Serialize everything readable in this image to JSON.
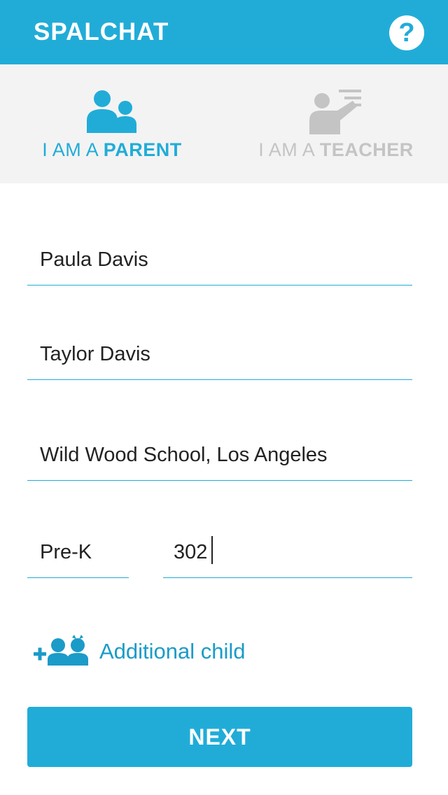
{
  "header": {
    "title": "SPALCHAT",
    "help_icon": "question-circle-icon",
    "help_glyph": "?"
  },
  "roles": {
    "selected": "parent",
    "parent": {
      "prefix": "I AM A ",
      "bold": "PARENT",
      "icon": "parent-child-icon",
      "color": "#21acd8"
    },
    "teacher": {
      "prefix": "I AM A ",
      "bold": "TEACHER",
      "icon": "teacher-board-icon",
      "color": "#c4c4c4"
    }
  },
  "form": {
    "parent_name": "Paula Davis",
    "child_name": "Taylor Davis",
    "school": "Wild Wood School, Los Angeles",
    "grade": "Pre-K",
    "classroom": "302"
  },
  "additional_child": {
    "label": "Additional child",
    "icon": "add-children-icon"
  },
  "next_button": {
    "label": "NEXT"
  },
  "colors": {
    "accent": "#21acd8",
    "background": "#ffffff",
    "role_bar": "#f3f3f3",
    "inactive": "#c4c4c4",
    "text": "#222222"
  }
}
